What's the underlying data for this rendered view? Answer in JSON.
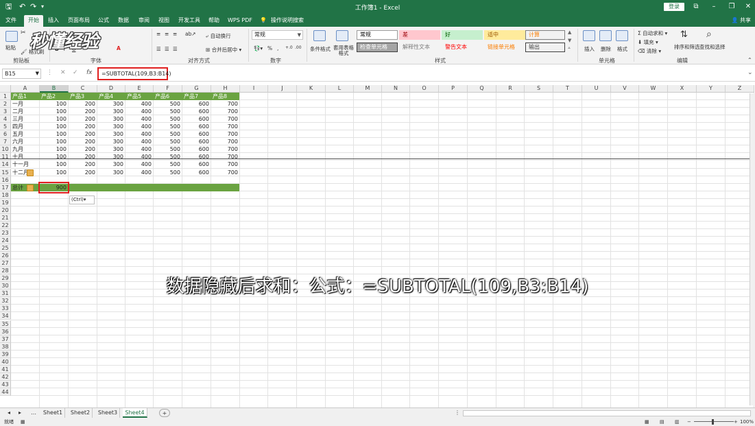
{
  "app": {
    "title": "工作簿1  -  Excel",
    "login": "登录",
    "share": "共享",
    "window_min": "–",
    "window_restore": "❐",
    "window_close": "✕",
    "ribbon_opts": "⧉"
  },
  "tabs": [
    "文件",
    "开始",
    "插入",
    "页面布局",
    "公式",
    "数据",
    "审阅",
    "视图",
    "开发工具",
    "帮助",
    "WPS PDF",
    "操作说明搜索"
  ],
  "ribbon": {
    "clipboard": {
      "paste": "粘贴",
      "format_painter": "格式刷",
      "label": "剪贴板"
    },
    "font": {
      "label": "字体",
      "bold": "B",
      "italic": "I",
      "underline": "U"
    },
    "alignment": {
      "wrap": "自动换行",
      "merge": "合并后居中",
      "label": "对齐方式"
    },
    "number": {
      "format": "常规",
      "percent": "%",
      "comma": ",",
      "label": "数字"
    },
    "styles": {
      "conditional": "条件格式",
      "table_format": "套用表格格式",
      "boxes": [
        {
          "text": "常规",
          "bg": "#ffffff",
          "color": "#000000",
          "border": "#9c9c9c"
        },
        {
          "text": "差",
          "bg": "#ffc7ce",
          "color": "#9c0006",
          "border": "#ffc7ce"
        },
        {
          "text": "好",
          "bg": "#c6efce",
          "color": "#006100",
          "border": "#c6efce"
        },
        {
          "text": "适中",
          "bg": "#ffeb9c",
          "color": "#9c5700",
          "border": "#ffeb9c"
        },
        {
          "text": "计算",
          "bg": "#f2f2f2",
          "color": "#fa7d00",
          "border": "#7f7f7f"
        },
        {
          "text": "检查单元格",
          "bg": "#a5a5a5",
          "color": "#ffffff",
          "border": "#3f3f3f"
        },
        {
          "text": "解释性文本",
          "bg": "#f3f3f3",
          "color": "#7f7f7f",
          "border": "#f3f3f3"
        },
        {
          "text": "警告文本",
          "bg": "#f3f3f3",
          "color": "#ff0000",
          "border": "#f3f3f3"
        },
        {
          "text": "链接单元格",
          "bg": "#f3f3f3",
          "color": "#fa7d00",
          "border": "#f3f3f3"
        },
        {
          "text": "输出",
          "bg": "#f2f2f2",
          "color": "#3f3f3f",
          "border": "#3f3f3f"
        }
      ],
      "label": "样式"
    },
    "cells": {
      "insert": "插入",
      "delete": "删除",
      "format": "格式",
      "label": "单元格"
    },
    "editing": {
      "autosum": "自动求和",
      "fill": "填充",
      "clear": "清除",
      "sort": "排序和筛选",
      "find": "查找和选择",
      "label": "编辑"
    }
  },
  "watermark": "秒懂经验",
  "formula_bar": {
    "name_box": "B15",
    "cancel": "✕",
    "enter": "✓",
    "fx": "fx",
    "formula": "=SUBTOTAL(109,B3:B14)"
  },
  "grid": {
    "columns": [
      "A",
      "B",
      "C",
      "D",
      "E",
      "F",
      "G",
      "H",
      "I",
      "J",
      "K",
      "L",
      "M",
      "N",
      "O",
      "P",
      "Q",
      "R",
      "S",
      "T",
      "U",
      "V",
      "W",
      "X",
      "Y",
      "Z"
    ],
    "rows": [
      {
        "n": "1",
        "cells": [
          "产品1",
          "产品2",
          "产品3",
          "产品4",
          "产品5",
          "产品6",
          "产品7",
          "产品8"
        ],
        "header": true
      },
      {
        "n": "2",
        "cells": [
          "一月",
          "100",
          "200",
          "300",
          "400",
          "500",
          "600",
          "700"
        ]
      },
      {
        "n": "3",
        "cells": [
          "二月",
          "100",
          "200",
          "300",
          "400",
          "500",
          "600",
          "700"
        ]
      },
      {
        "n": "4",
        "cells": [
          "三月",
          "100",
          "200",
          "300",
          "400",
          "500",
          "600",
          "700"
        ]
      },
      {
        "n": "5",
        "cells": [
          "四月",
          "100",
          "200",
          "300",
          "400",
          "500",
          "600",
          "700"
        ]
      },
      {
        "n": "6",
        "cells": [
          "五月",
          "100",
          "200",
          "300",
          "400",
          "500",
          "600",
          "700"
        ]
      },
      {
        "n": "7",
        "cells": [
          "六月",
          "100",
          "200",
          "300",
          "400",
          "500",
          "600",
          "700"
        ]
      },
      {
        "n": "10",
        "cells": [
          "九月",
          "100",
          "200",
          "300",
          "400",
          "500",
          "600",
          "700"
        ]
      },
      {
        "n": "11",
        "cells": [
          "十月",
          "100",
          "200",
          "300",
          "400",
          "500",
          "600",
          "700"
        ]
      },
      {
        "n": "14",
        "cells": [
          "十一月",
          "100",
          "200",
          "300",
          "400",
          "500",
          "600",
          "700"
        ]
      },
      {
        "n": "15",
        "cells": [
          "十二月",
          "100",
          "200",
          "300",
          "400",
          "500",
          "600",
          "700"
        ]
      },
      {
        "n": "16",
        "cells": []
      },
      {
        "n": "17",
        "cells": [
          "总计",
          "900"
        ],
        "total": true
      },
      {
        "n": "18",
        "cells": []
      },
      {
        "n": "19",
        "cells": []
      },
      {
        "n": "20",
        "cells": []
      },
      {
        "n": "21",
        "cells": []
      },
      {
        "n": "22",
        "cells": []
      },
      {
        "n": "23",
        "cells": []
      },
      {
        "n": "24",
        "cells": []
      },
      {
        "n": "25",
        "cells": []
      },
      {
        "n": "26",
        "cells": []
      },
      {
        "n": "27",
        "cells": []
      },
      {
        "n": "28",
        "cells": []
      },
      {
        "n": "29",
        "cells": []
      },
      {
        "n": "30",
        "cells": []
      },
      {
        "n": "31",
        "cells": []
      },
      {
        "n": "32",
        "cells": []
      },
      {
        "n": "33",
        "cells": []
      },
      {
        "n": "34",
        "cells": []
      },
      {
        "n": "35",
        "cells": []
      },
      {
        "n": "36",
        "cells": []
      },
      {
        "n": "37",
        "cells": []
      },
      {
        "n": "38",
        "cells": []
      },
      {
        "n": "39",
        "cells": []
      },
      {
        "n": "40",
        "cells": []
      },
      {
        "n": "41",
        "cells": []
      },
      {
        "n": "42",
        "cells": []
      },
      {
        "n": "43",
        "cells": []
      },
      {
        "n": "44",
        "cells": []
      }
    ],
    "paste_options": "(Ctrl)▾"
  },
  "subtitle": "数据隐藏后求和：公式：=SUBTOTAL(109,B3:B14)",
  "sheets": [
    "Sheet1",
    "Sheet2",
    "Sheet3",
    "Sheet4"
  ],
  "active_sheet": "Sheet4",
  "add_sheet": "+",
  "status": {
    "ready": "就绪",
    "zoom": "100%"
  },
  "colors": {
    "accent": "#217346",
    "header_band": "#6aa341",
    "highlight": "#e02020"
  }
}
